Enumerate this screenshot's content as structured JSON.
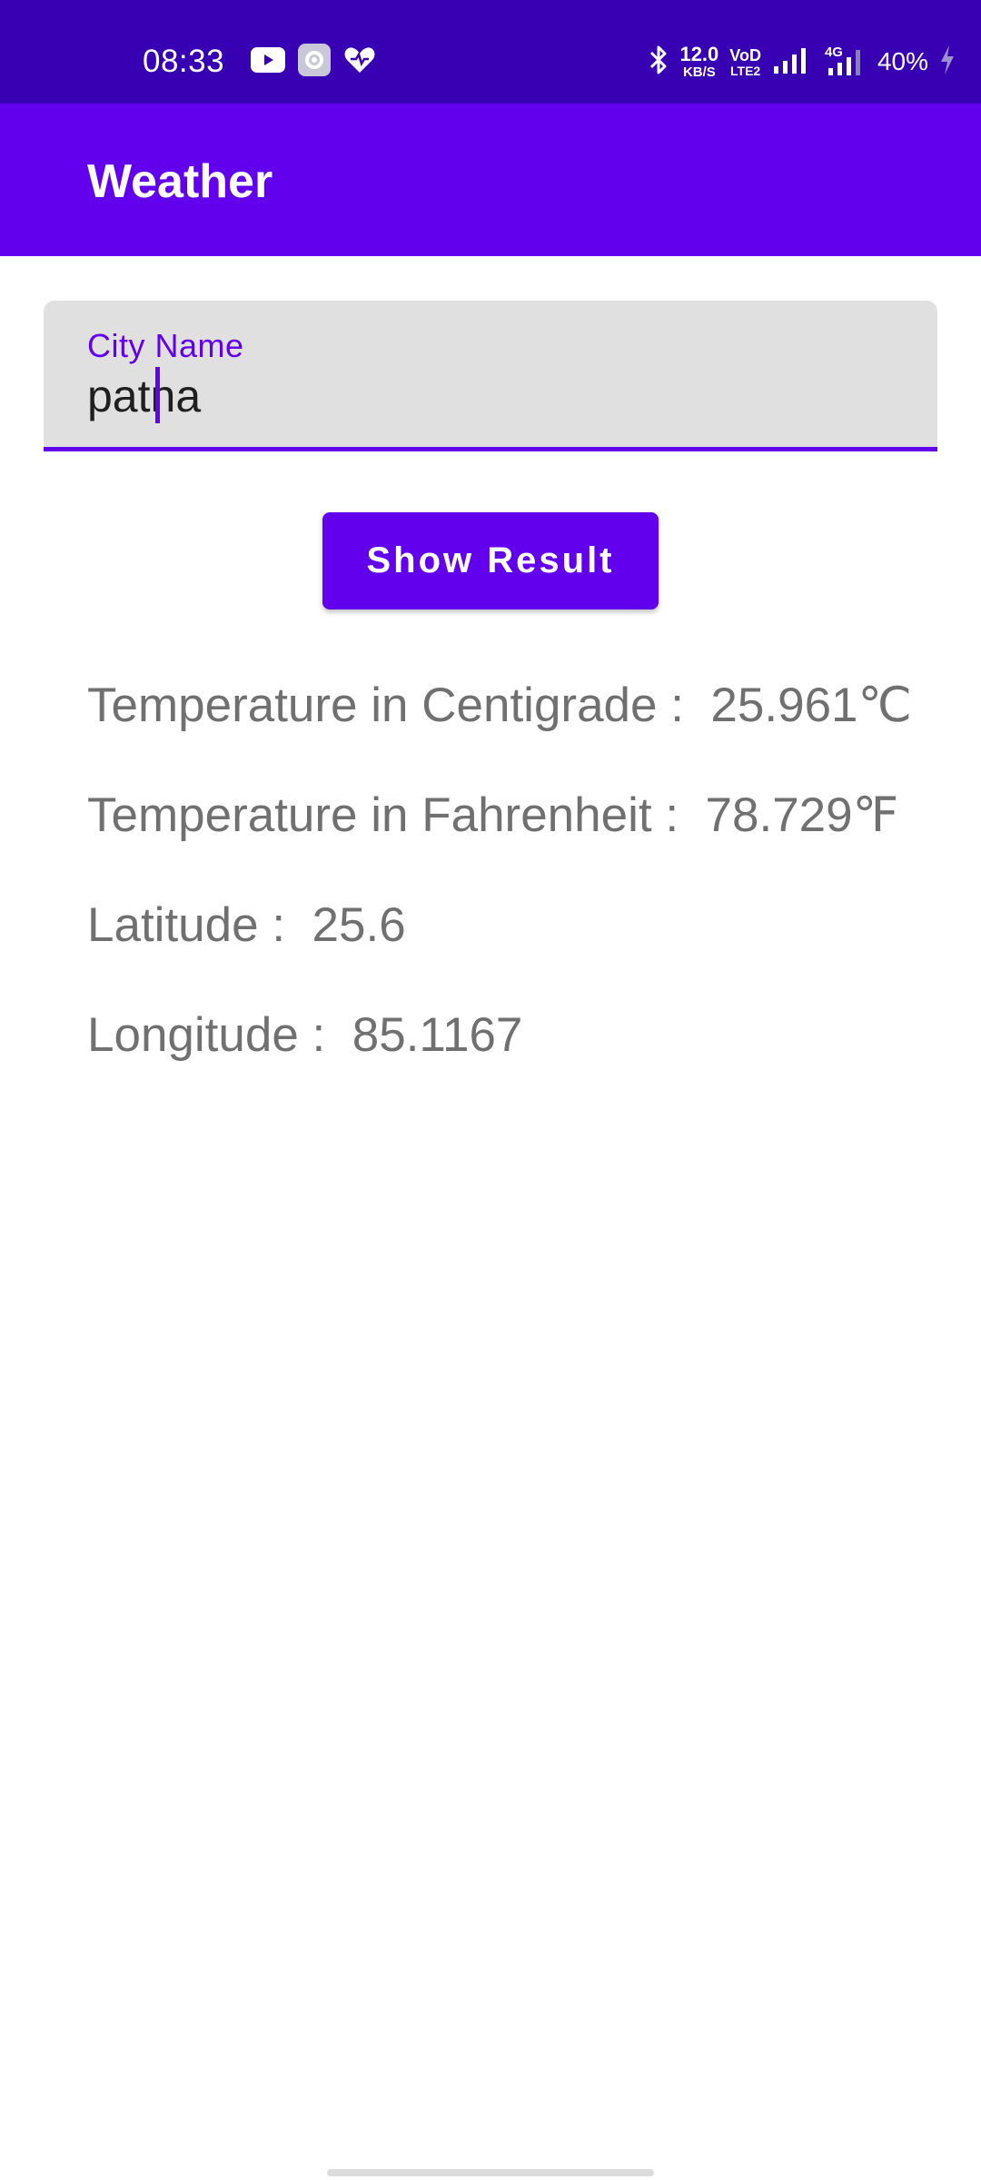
{
  "status_bar": {
    "time": "08:33",
    "net_speed": "12.0",
    "net_speed_unit": "KB/S",
    "volte": "VoD",
    "volte_sub": "LTE2",
    "network_type": "4G",
    "battery": "40%",
    "background_color": "#3700b3",
    "icons": [
      "youtube-icon",
      "settings-app-icon",
      "health-heart-icon",
      "bluetooth-icon",
      "signal-icon",
      "signal-4g-icon",
      "charging-bolt-icon"
    ]
  },
  "app_bar": {
    "title": "Weather",
    "background_color": "#6200ee"
  },
  "city_field": {
    "label": "City Name",
    "value": "patna",
    "accent_color": "#6200ee"
  },
  "show_result_button": {
    "label": "Show Result"
  },
  "results": [
    {
      "label": "Temperature in Centigrade :",
      "value": "25.961℃"
    },
    {
      "label": "Temperature in Fahrenheit :",
      "value": "78.729℉"
    },
    {
      "label": "Latitude :",
      "value": "25.6"
    },
    {
      "label": "Longitude :",
      "value": "85.1167"
    }
  ]
}
